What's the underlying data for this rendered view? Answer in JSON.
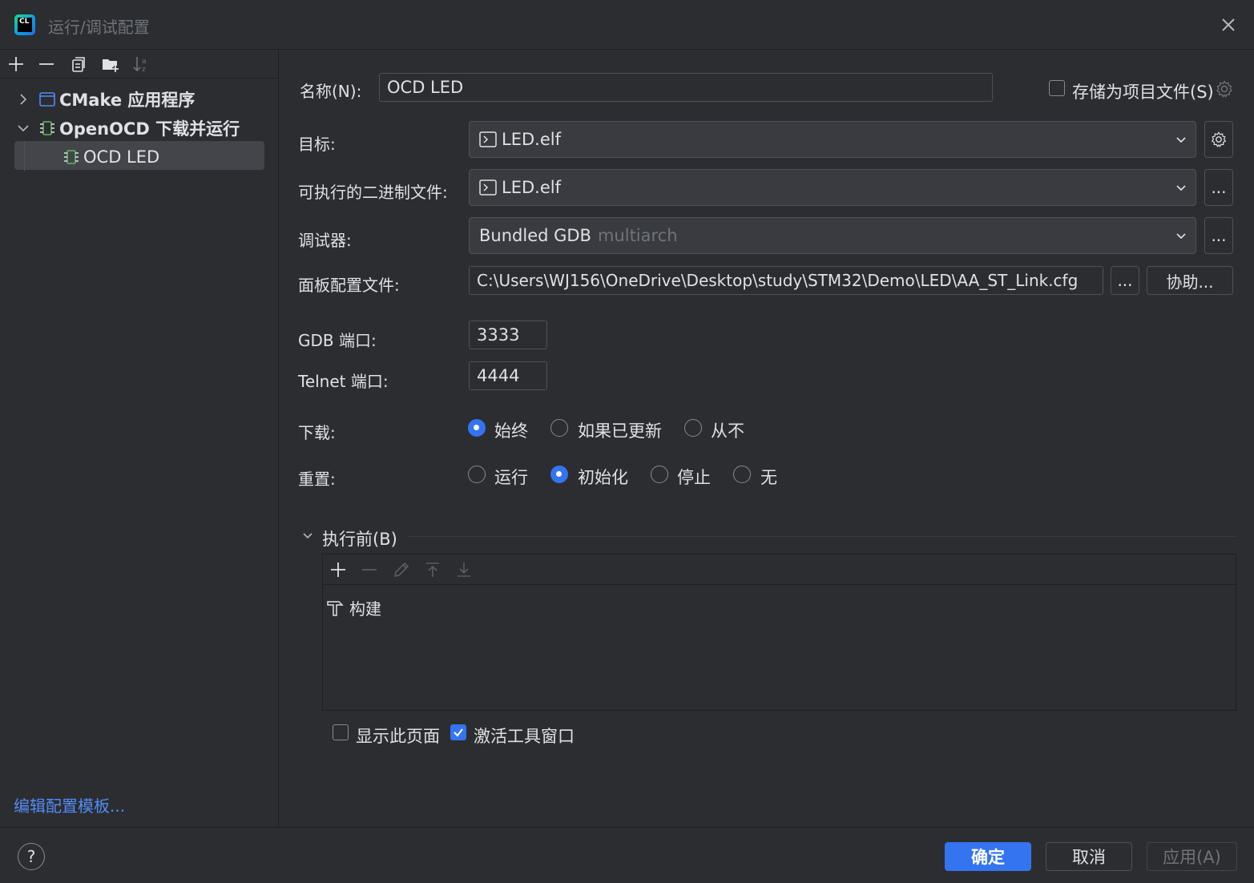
{
  "window": {
    "title": "运行/调试配置"
  },
  "tree": {
    "items": [
      {
        "label": "CMake 应用程序",
        "icon": "cmake-app-icon"
      },
      {
        "label": "OpenOCD 下载并运行",
        "icon": "chip-icon"
      },
      {
        "label": "OCD LED",
        "icon": "chip-icon"
      }
    ]
  },
  "left": {
    "edit_templates": "编辑配置模板..."
  },
  "form": {
    "name_label": "名称(N):",
    "name_value": "OCD LED",
    "store_label": "存储为项目文件(S)",
    "target_label": "目标:",
    "target_value": "LED.elf",
    "executable_label": "可执行的二进制文件:",
    "executable_value": "LED.elf",
    "debugger_label": "调试器:",
    "debugger_value": "Bundled GDB",
    "debugger_hint": "multiarch",
    "board_label": "面板配置文件:",
    "board_value": "C:\\Users\\WJ156\\OneDrive\\Desktop\\study\\STM32\\Demo\\LED\\AA_ST_Link.cfg",
    "browse_label": "...",
    "assist_label": "协助...",
    "gdb_port_label": "GDB 端口:",
    "gdb_port_value": "3333",
    "telnet_port_label": "Telnet 端口:",
    "telnet_port_value": "4444",
    "download_label": "下载:",
    "download_options": [
      "始终",
      "如果已更新",
      "从不"
    ],
    "download_selected": "始终",
    "reset_label": "重置:",
    "reset_options": [
      "运行",
      "初始化",
      "停止",
      "无"
    ],
    "reset_selected": "初始化"
  },
  "before_launch": {
    "title": "执行前(B)",
    "tasks": [
      "构建"
    ],
    "show_page_label": "显示此页面",
    "show_page_checked": false,
    "activate_window_label": "激活工具窗口",
    "activate_window_checked": true
  },
  "footer": {
    "help": "?",
    "ok": "确定",
    "cancel": "取消",
    "apply": "应用(A)"
  },
  "colors": {
    "accent": "#3574f0",
    "background": "#2b2d30",
    "link": "#548af7"
  }
}
